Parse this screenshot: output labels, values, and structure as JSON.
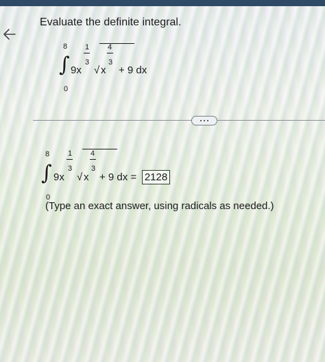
{
  "title": "Evaluate the definite integral.",
  "question": {
    "upper": "8",
    "lower": "0",
    "coef_term": "9x",
    "exp1_num": "1",
    "exp1_den": "3",
    "root_sign": "√",
    "x": "x",
    "exp2_num": "4",
    "exp2_den": "3",
    "rest": "+ 9 dx"
  },
  "answer_row": {
    "upper": "8",
    "lower": "0",
    "coef_term": "9x",
    "exp1_num": "1",
    "exp1_den": "3",
    "root_sign": "√",
    "x": "x",
    "exp2_num": "4",
    "exp2_den": "3",
    "rest": "+ 9 dx =",
    "answer_value": "2128"
  },
  "hint": "(Type an exact answer, using radicals as needed.)",
  "icons": {
    "back": "back-arrow-icon",
    "more": "more-dots-icon"
  }
}
